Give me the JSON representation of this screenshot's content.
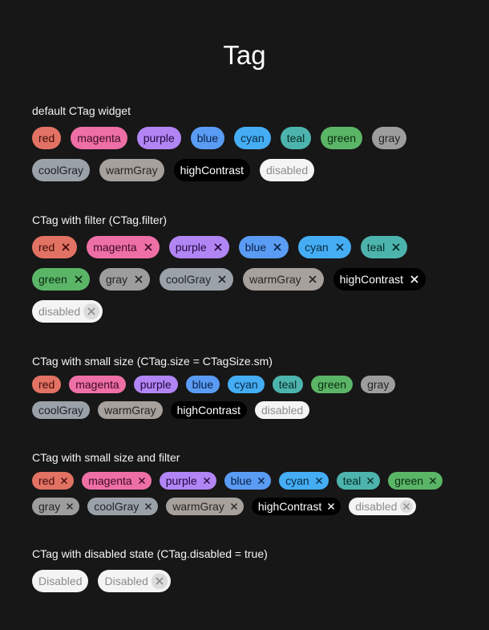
{
  "page": {
    "title": "Tag"
  },
  "sections": [
    {
      "title": "default CTag widget",
      "size": "md",
      "filter": false,
      "tags": [
        "red",
        "magenta",
        "purple",
        "blue",
        "cyan",
        "teal",
        "green",
        "gray",
        "coolGray",
        "warmGray",
        "highContrast",
        "disabled"
      ]
    },
    {
      "title": "CTag with filter (CTag.filter)",
      "size": "md",
      "filter": true,
      "tags": [
        "red",
        "magenta",
        "purple",
        "blue",
        "cyan",
        "teal",
        "green",
        "gray",
        "coolGray",
        "warmGray",
        "highContrast",
        "disabled"
      ]
    },
    {
      "title": "CTag with small size (CTag.size = CTagSize.sm)",
      "size": "sm",
      "filter": false,
      "tags": [
        "red",
        "magenta",
        "purple",
        "blue",
        "cyan",
        "teal",
        "green",
        "gray",
        "coolGray",
        "warmGray",
        "highContrast",
        "disabled"
      ]
    },
    {
      "title": "CTag with small size and filter",
      "size": "sm",
      "filter": true,
      "tags": [
        "red",
        "magenta",
        "purple",
        "blue",
        "cyan",
        "teal",
        "green",
        "gray",
        "coolGray",
        "warmGray",
        "highContrast",
        "disabled"
      ]
    },
    {
      "title": "CTag with disabled state (CTag.disabled = true)",
      "size": "md",
      "disabled_tags": [
        {
          "label": "Disabled",
          "filter": false
        },
        {
          "label": "Disabled",
          "filter": true
        }
      ]
    }
  ],
  "icons": {
    "close": "close-icon"
  },
  "colors": {
    "background": "#171717",
    "red": "#e27263",
    "magenta": "#ee6fa5",
    "purple": "#b185f4",
    "blue": "#5a9cf4",
    "cyan": "#45adf4",
    "teal": "#4db4ad",
    "green": "#5bb567",
    "gray": "#9d9d9d",
    "coolGray": "#9aa1a8",
    "warmGray": "#a7a19e",
    "highContrast": "#000000",
    "disabled": "#f4f4f4"
  }
}
